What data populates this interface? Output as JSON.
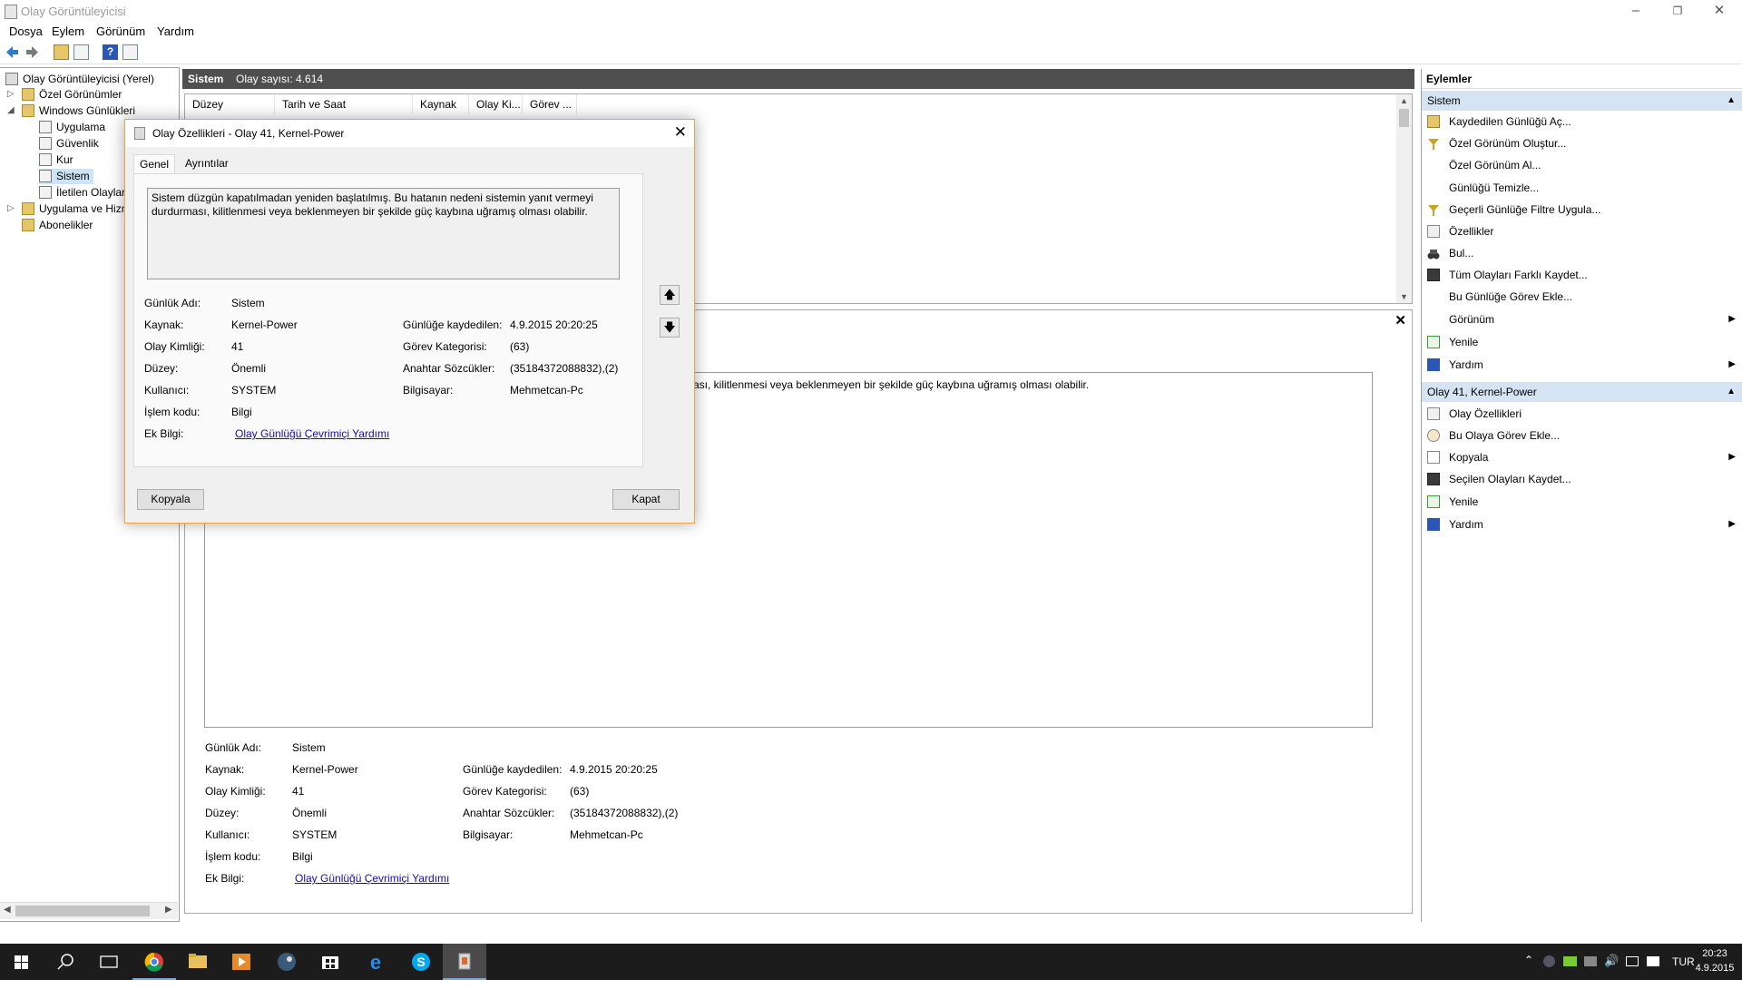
{
  "window": {
    "title": "Olay Görüntüleyicisi"
  },
  "menu": [
    "Dosya",
    "Eylem",
    "Görünüm",
    "Yardım"
  ],
  "tree": [
    {
      "label": "Olay Görüntüleyicisi (Yerel)"
    },
    {
      "label": "Özel Görünümler"
    },
    {
      "label": "Windows Günlükleri"
    },
    {
      "label": "Uygulama"
    },
    {
      "label": "Güvenlik"
    },
    {
      "label": "Kur"
    },
    {
      "label": "Sistem"
    },
    {
      "label": "İletilen Olaylar"
    },
    {
      "label": "Uygulama ve Hizmet Günlükleri"
    },
    {
      "label": "Abonelikler"
    }
  ],
  "center": {
    "log_name": "Sistem",
    "count_label": "Olay sayısı: 4.614",
    "columns": [
      "Düzey",
      "Tarih ve Saat",
      "Kaynak",
      "Olay Ki...",
      "Görev ..."
    ],
    "detail_text_partial": "ası, kilitlenmesi veya beklenmeyen bir şekilde güç kaybına uğramış olması olabilir."
  },
  "event": {
    "labels": {
      "log_name": "Günlük Adı:",
      "source": "Kaynak:",
      "event_id": "Olay Kimliği:",
      "level": "Düzey:",
      "user": "Kullanıcı:",
      "opcode": "İşlem kodu:",
      "more_info": "Ek Bilgi:",
      "logged": "Günlüğe kaydedilen:",
      "task_category": "Görev Kategorisi:",
      "keywords": "Anahtar Sözcükler:",
      "computer": "Bilgisayar:"
    },
    "values": {
      "log_name": "Sistem",
      "source": "Kernel-Power",
      "event_id": "41",
      "level": "Önemli",
      "user": "SYSTEM",
      "opcode": "Bilgi",
      "more_info": "Olay Günlüğü Çevrimiçi Yardımı",
      "logged": "4.9.2015 20:20:25",
      "task_category": "(63)",
      "keywords": "(35184372088832),(2)",
      "computer": "Mehmetcan-Pc"
    }
  },
  "dialog": {
    "title": "Olay Özellikleri - Olay 41, Kernel-Power",
    "tabs": [
      "Genel",
      "Ayrıntılar"
    ],
    "description_line1": "Sistem düzgün kapatılmadan yeniden başlatılmış. Bu hatanın nedeni sistemin yanıt vermeyi",
    "description_line2": "durdurması, kilitlenmesi veya beklenmeyen bir şekilde güç kaybına uğramış olması olabilir.",
    "copy_button": "Kopyala",
    "close_button": "Kapat"
  },
  "actions": {
    "title": "Eylemler",
    "section1": "Sistem",
    "items1": [
      "Kaydedilen Günlüğü Aç...",
      "Özel Görünüm Oluştur...",
      "Özel Görünüm Al...",
      "Günlüğü Temizle...",
      "Geçerli Günlüğe Filtre Uygula...",
      "Özellikler",
      "Bul...",
      "Tüm Olayları Farklı Kaydet...",
      "Bu Günlüğe Görev Ekle...",
      "Görünüm",
      "Yenile",
      "Yardım"
    ],
    "section2": "Olay 41, Kernel-Power",
    "items2": [
      "Olay Özellikleri",
      "Bu Olaya Görev Ekle...",
      "Kopyala",
      "Seçilen Olayları Kaydet...",
      "Yenile",
      "Yardım"
    ]
  },
  "taskbar": {
    "lang": "TUR",
    "time": "20:23",
    "date": "4.9.2015"
  }
}
